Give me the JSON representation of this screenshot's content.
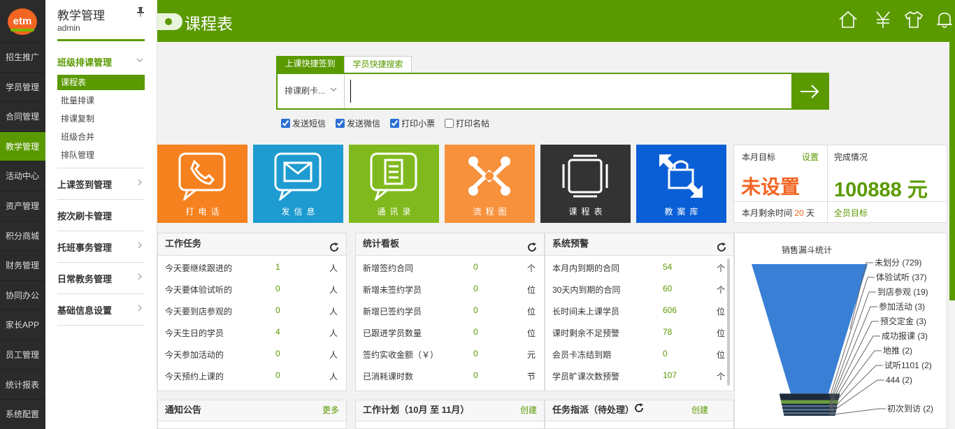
{
  "logo": {
    "text": "etm"
  },
  "leftnav": [
    {
      "label": "招生推广",
      "active": false
    },
    {
      "label": "学员管理",
      "active": false
    },
    {
      "label": "合同管理",
      "active": false
    },
    {
      "label": "教学管理",
      "active": true
    },
    {
      "label": "活动中心",
      "active": false
    },
    {
      "label": "资产管理",
      "active": false
    },
    {
      "label": "积分商城",
      "active": false
    },
    {
      "label": "财务管理",
      "active": false
    },
    {
      "label": "协同办公",
      "active": false
    },
    {
      "label": "家长APP",
      "active": false
    },
    {
      "label": "员工管理",
      "active": false
    },
    {
      "label": "统计报表",
      "active": false
    },
    {
      "label": "系统配置",
      "active": false
    }
  ],
  "subnav": {
    "title": "教学管理",
    "user": "admin",
    "open_group": {
      "label": "班级排课管理",
      "items": [
        {
          "label": "课程表",
          "active": true
        },
        {
          "label": "批量排课",
          "active": false
        },
        {
          "label": "排课复制",
          "active": false
        },
        {
          "label": "班级合并",
          "active": false
        },
        {
          "label": "排队管理",
          "active": false
        }
      ]
    },
    "groups": [
      {
        "label": "上课签到管理",
        "chevron": true
      },
      {
        "label": "按次刷卡管理",
        "chevron": false
      },
      {
        "label": "托班事务管理",
        "chevron": true
      },
      {
        "label": "日常教务管理",
        "chevron": true
      },
      {
        "label": "基础信息设置",
        "chevron": true
      }
    ]
  },
  "header": {
    "title": "课程表",
    "icons": [
      "home-icon",
      "yen-icon",
      "shirt-icon",
      "bell-icon"
    ]
  },
  "quick": {
    "tab_checkin": "上课快捷签到",
    "tab_search": "学员快捷搜索",
    "select_value": "排课刷卡...",
    "input_value": "",
    "options": [
      {
        "label": "发送短信",
        "checked": true
      },
      {
        "label": "发送微信",
        "checked": true
      },
      {
        "label": "打印小票",
        "checked": true
      },
      {
        "label": "打印名帖",
        "checked": false
      }
    ]
  },
  "tiles": [
    {
      "label": "打电话",
      "color": "#f5821f",
      "icon": "phone-icon"
    },
    {
      "label": "发信息",
      "color": "#1e9bd0",
      "icon": "message-icon"
    },
    {
      "label": "通讯录",
      "color": "#80b91e",
      "icon": "contacts-icon"
    },
    {
      "label": "流程图",
      "color": "#f7913c",
      "icon": "flowchart-icon"
    },
    {
      "label": "课程表",
      "color": "#333333",
      "icon": "schedule-icon"
    },
    {
      "label": "教案库",
      "color": "#0a5fd6",
      "icon": "lesson-library-icon"
    }
  ],
  "target": {
    "monthly_label": "本月目标",
    "settings_link": "设置",
    "monthly_value": "未设置",
    "completion_label": "完成情况",
    "completion_value": "100888 元",
    "remaining_prefix": "本月剩余时间",
    "remaining_days": "20",
    "remaining_suffix": "天",
    "all_staff_link": "全员目标"
  },
  "panels": [
    {
      "title": "工作任务",
      "rows": [
        {
          "label": "今天要继续跟进的",
          "value": "1",
          "unit": "人"
        },
        {
          "label": "今天要体验试听的",
          "value": "0",
          "unit": "人"
        },
        {
          "label": "今天要到店参观的",
          "value": "0",
          "unit": "人"
        },
        {
          "label": "今天生日的学员",
          "value": "4",
          "unit": "人"
        },
        {
          "label": "今天参加活动的",
          "value": "0",
          "unit": "人"
        },
        {
          "label": "今天预约上课的",
          "value": "0",
          "unit": "人"
        }
      ]
    },
    {
      "title": "统计看板",
      "rows": [
        {
          "label": "新增签约合同",
          "value": "0",
          "unit": "个"
        },
        {
          "label": "新增未签约学员",
          "value": "0",
          "unit": "位"
        },
        {
          "label": "新增已签约学员",
          "value": "0",
          "unit": "位"
        },
        {
          "label": "已跟进学员数量",
          "value": "0",
          "unit": "位"
        },
        {
          "label": "签约实收金额（￥）",
          "value": "0",
          "unit": "元"
        },
        {
          "label": "已消耗课时数",
          "value": "0",
          "unit": "节"
        }
      ]
    },
    {
      "title": "系统预警",
      "rows": [
        {
          "label": "本月内到期的合同",
          "value": "54",
          "unit": "个"
        },
        {
          "label": "30天内到期的合同",
          "value": "60",
          "unit": "个"
        },
        {
          "label": "长时间未上课学员",
          "value": "606",
          "unit": "位"
        },
        {
          "label": "课时剩余不足预警",
          "value": "78",
          "unit": "位"
        },
        {
          "label": "会员卡冻结到期",
          "value": "0",
          "unit": "位"
        },
        {
          "label": "学员旷课次数预警",
          "value": "107",
          "unit": "个"
        }
      ]
    }
  ],
  "bottom_panels": [
    {
      "title": "通知公告",
      "link": "更多"
    },
    {
      "title": "工作计划（10月 至 11月）",
      "link": "创建"
    },
    {
      "title": "任务指派（待处理）",
      "link": "创建"
    }
  ],
  "funnel": {
    "title": "销售漏斗统计",
    "main_color": "#3a7fd6",
    "entries": [
      {
        "name": "未划分",
        "value": 729
      },
      {
        "name": "体验试听",
        "value": 37
      },
      {
        "name": "到店参观",
        "value": 19
      },
      {
        "name": "参加活动",
        "value": 3
      },
      {
        "name": "预交定金",
        "value": 3
      },
      {
        "name": "成功报课",
        "value": 3
      },
      {
        "name": "地推",
        "value": 2
      },
      {
        "name": "试听1101",
        "value": 2
      },
      {
        "name": "444",
        "value": 2
      },
      {
        "name": "初次到访",
        "value": 2
      }
    ]
  }
}
